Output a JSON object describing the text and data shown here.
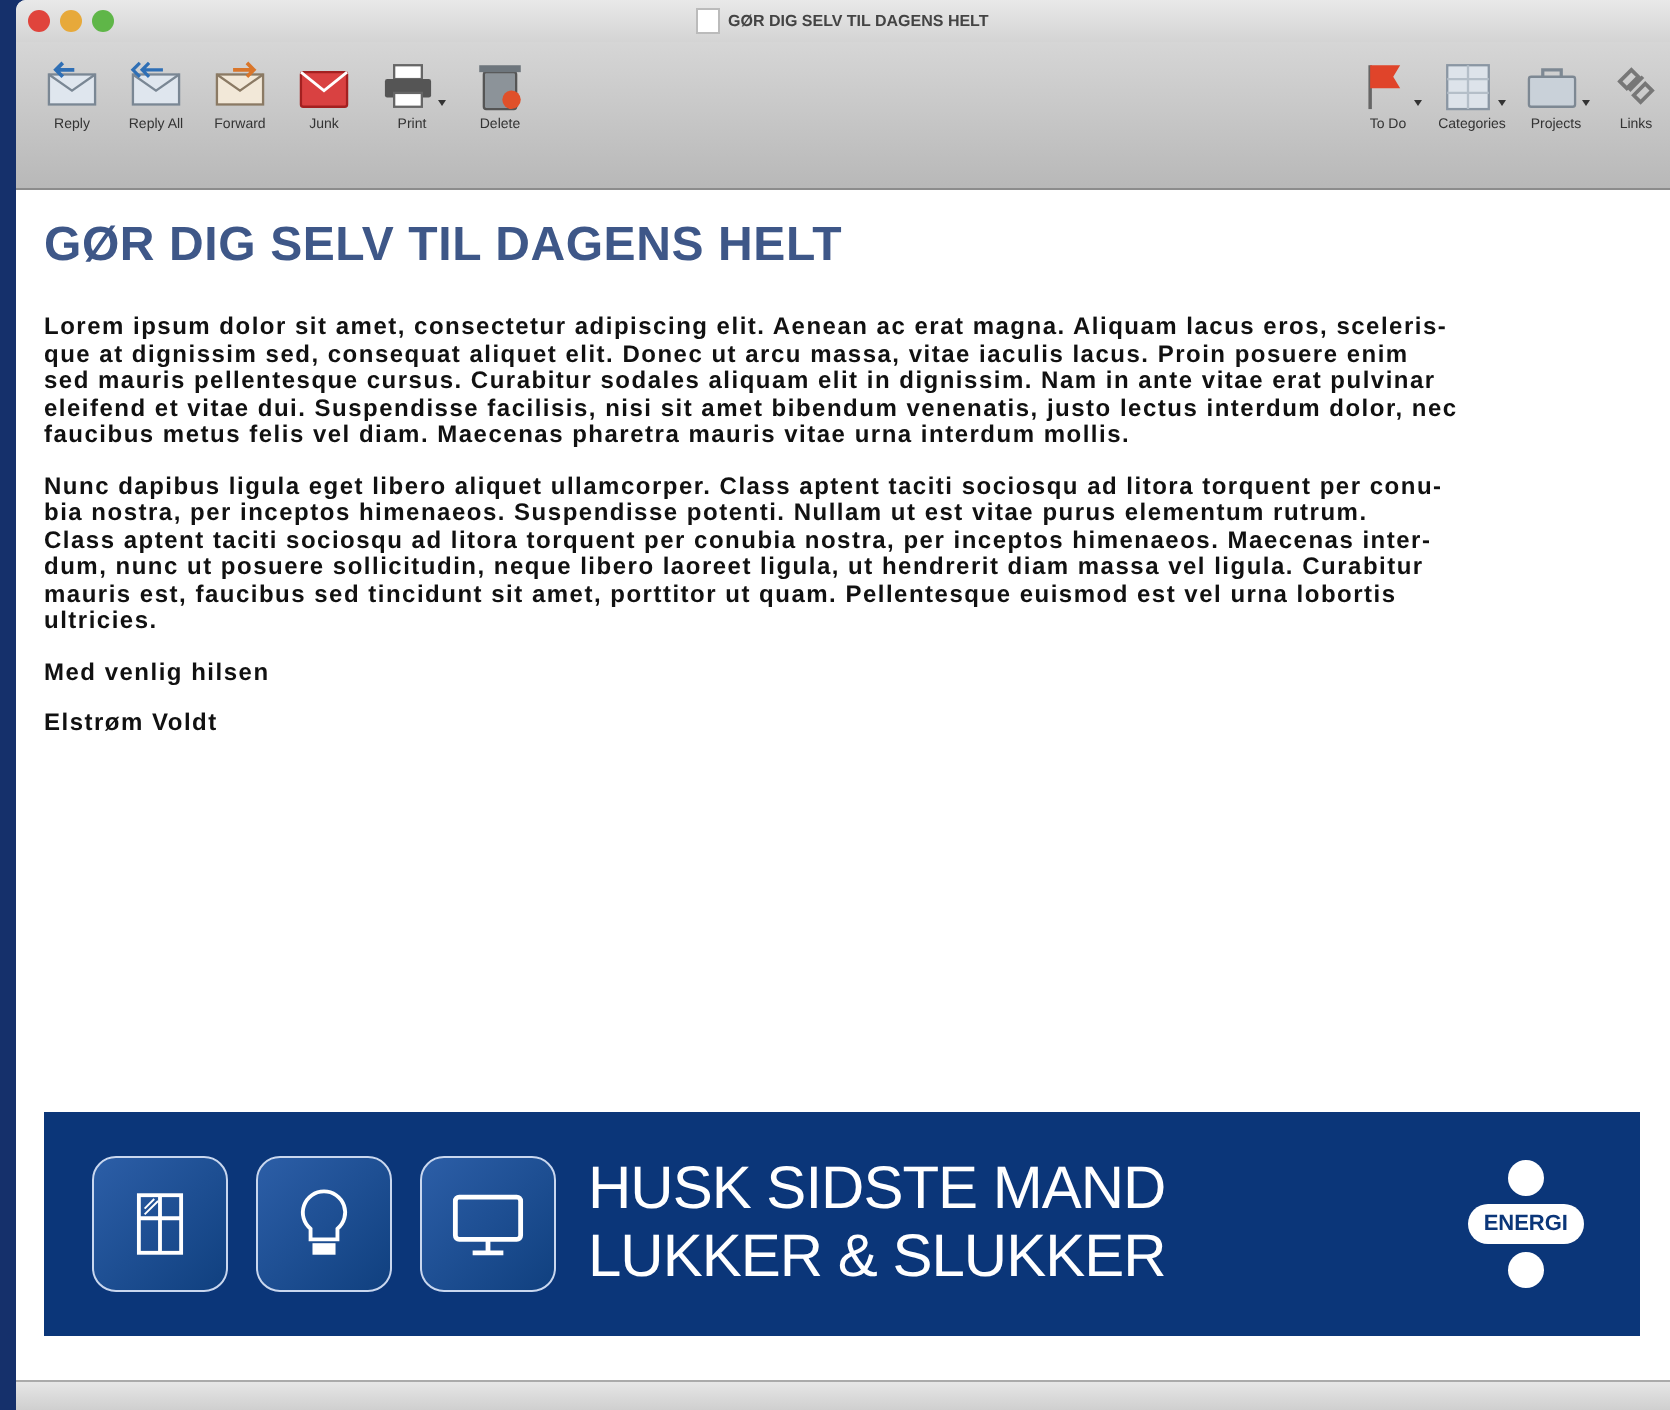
{
  "window": {
    "title": "GØR DIG SELV TIL DAGENS HELT"
  },
  "toolbar": {
    "left": [
      {
        "label": "Reply",
        "has_menu": false
      },
      {
        "label": "Reply All",
        "has_menu": false
      },
      {
        "label": "Forward",
        "has_menu": false
      },
      {
        "label": "Junk",
        "has_menu": false
      },
      {
        "label": "Print",
        "has_menu": true
      },
      {
        "label": "Delete",
        "has_menu": false
      }
    ],
    "right": [
      {
        "label": "To Do",
        "has_menu": true
      },
      {
        "label": "Categories",
        "has_menu": true
      },
      {
        "label": "Projects",
        "has_menu": true
      },
      {
        "label": "Links",
        "has_menu": false
      }
    ]
  },
  "message": {
    "heading": "GØR DIG SELV TIL DAGENS HELT",
    "paragraphs": [
      {
        "lines": [
          "Lorem ipsum dolor sit amet, consectetur adipiscing elit. Aenean ac erat magna. Aliquam lacus eros, sceleris-",
          "que at dignissim sed, consequat aliquet elit. Donec ut arcu massa, vitae iaculis lacus. Proin posuere enim",
          "sed mauris pellentesque cursus. Curabitur sodales aliquam elit in dignissim. Nam in ante vitae erat pulvinar",
          "eleifend et vitae dui. Suspendisse facilisis, nisi sit amet bibendum venenatis, justo lectus interdum dolor, nec",
          "faucibus metus felis vel diam. Maecenas pharetra mauris vitae urna interdum mollis."
        ]
      },
      {
        "lines": [
          "Nunc dapibus ligula eget libero aliquet ullamcorper. Class aptent taciti sociosqu ad litora torquent per conu-",
          "bia nostra, per inceptos himenaeos. Suspendisse potenti. Nullam ut est vitae purus elementum rutrum.",
          "Class aptent taciti sociosqu ad litora torquent per conubia nostra, per inceptos himenaeos. Maecenas inter-",
          "dum, nunc ut posuere sollicitudin, neque libero laoreet ligula, ut hendrerit diam massa vel ligula. Curabitur",
          "mauris est, faucibus sed tincidunt sit amet, porttitor ut quam. Pellentesque euismod est vel urna lobortis",
          "ultricies."
        ]
      },
      {
        "lines": [
          "Med venlig hilsen"
        ]
      },
      {
        "lines": [
          "Elstrøm Voldt"
        ]
      }
    ],
    "banner": {
      "slogan": [
        "HUSK SIDSTE MAND",
        "LUKKER & SLUKKER"
      ],
      "logo": "ENERGI"
    }
  }
}
